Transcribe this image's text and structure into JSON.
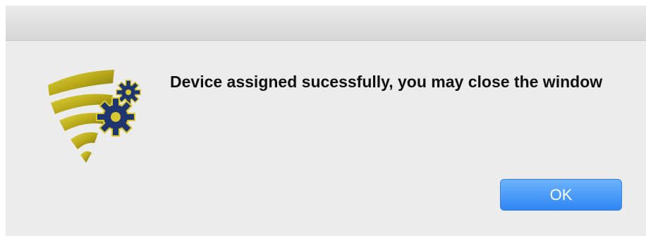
{
  "dialog": {
    "message": "Device assigned sucessfully, you may close the window",
    "icon": "shield-wifi-gears-icon",
    "ok_label": "OK"
  },
  "colors": {
    "dialog_background": "#ececec",
    "titlebar_top": "#ebebeb",
    "titlebar_bottom": "#d6d6d6",
    "button_accent": "#2f86f5",
    "icon_gold": "#c8b820",
    "icon_gear": "#1f3570"
  }
}
